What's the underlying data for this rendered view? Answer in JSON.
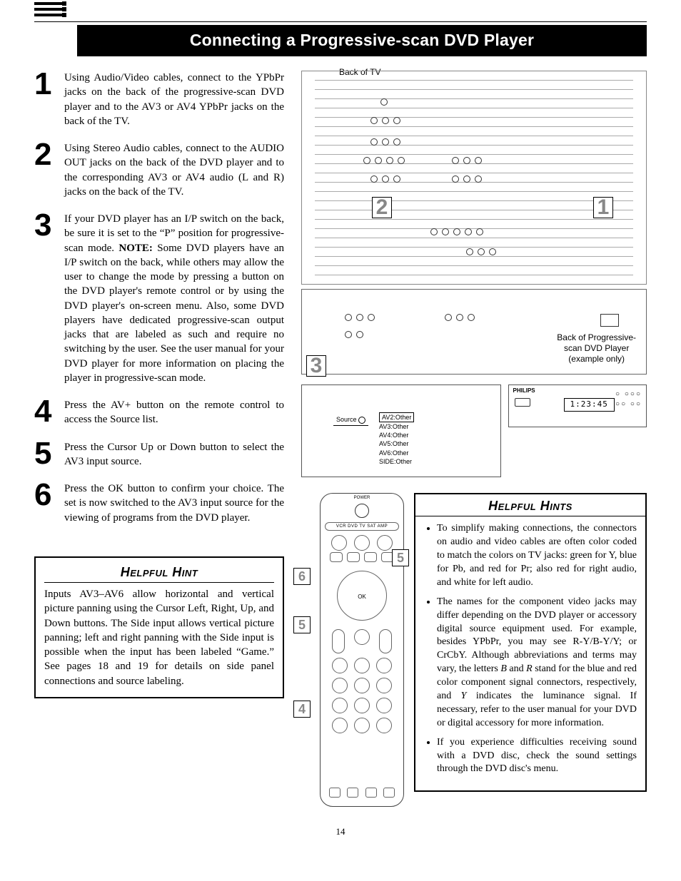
{
  "title": "Connecting a Progressive-scan DVD Player",
  "steps": [
    {
      "num": "1",
      "text": "Using Audio/Video cables, connect to the YPbPr jacks on the back of the progressive-scan DVD player and to the AV3 or AV4 YPbPr jacks on the back of the TV."
    },
    {
      "num": "2",
      "text": "Using Stereo Audio cables, connect to the AUDIO OUT jacks on the back of the DVD player and to the corresponding AV3 or AV4 audio (L and R) jacks on the back of the TV."
    },
    {
      "num": "3",
      "note_label": "NOTE:",
      "lead": "If your DVD player has an I/P switch on the back, be sure it is set to the “P” position for progressive-scan mode. ",
      "note_text": " Some DVD players have an I/P switch on the back, while others may allow the user to change the mode by pressing a button on the DVD player's remote control or by using the DVD player's on-screen menu. Also, some DVD players have dedicated progressive-scan output jacks that are labeled as such and require no switching by the user. See the user manual for your DVD player for more information on placing the player in progressive-scan mode."
    },
    {
      "num": "4",
      "text": "Press the AV+ button on the remote control to access the Source list."
    },
    {
      "num": "5",
      "text": "Press the Cursor Up or Down button to select the AV3 input source."
    },
    {
      "num": "6",
      "text": "Press the OK button to confirm your choice. The set is now switched to the AV3 input source for the viewing of programs from the DVD player."
    }
  ],
  "hint_left": {
    "title": "Helpful Hint",
    "body": "Inputs AV3–AV6 allow horizontal and vertical picture panning using the Cursor Left, Right, Up, and Down buttons. The Side input allows vertical picture panning; left and right panning with the Side input is possible when the input has been labeled “Game.” See pages 18 and 19 for details on side panel connections and source labeling."
  },
  "diagram": {
    "back_of_tv": "Back of TV",
    "back_of_player_l1": "Back of Progressive-",
    "back_of_player_l2": "scan DVD Player",
    "back_of_player_l3": "(example only)",
    "callouts": {
      "c1": "1",
      "c2": "2",
      "c3": "3",
      "c4": "4",
      "c5": "5",
      "c6": "6"
    }
  },
  "osd": {
    "source_label": "Source",
    "inputs": [
      "AV2:Other",
      "AV3:Other",
      "AV4:Other",
      "AV5:Other",
      "AV6:Other",
      "SIDE:Other"
    ]
  },
  "vcr": {
    "brand": "PHILIPS",
    "time": "1:23:45"
  },
  "remote": {
    "power": "POWER",
    "modes": "VCR  DVD  TV  SAT  AMP",
    "ok": "OK"
  },
  "hints_right": {
    "title": "Helpful Hints",
    "items": [
      "To simplify making connections, the connectors on audio and video cables are often color coded to match the colors on TV jacks: green for Y, blue for Pb, and red for Pr; also red for right audio, and white for left audio.",
      "The names for the component video jacks may differ depending on the DVD player or accessory digital source equipment used. For example, besides YPbPr, you may see R-Y/B-Y/Y; or CrCbY. Although abbreviations and terms may vary, the letters B and R stand for the blue and red color component signal connectors, respectively, and Y indicates the luminance signal. If necessary, refer to the user manual for your DVD or digital accessory for more information.",
      "If you experience difficulties receiving sound with a DVD disc, check the sound settings through the DVD disc's menu."
    ]
  },
  "page_number": "14"
}
